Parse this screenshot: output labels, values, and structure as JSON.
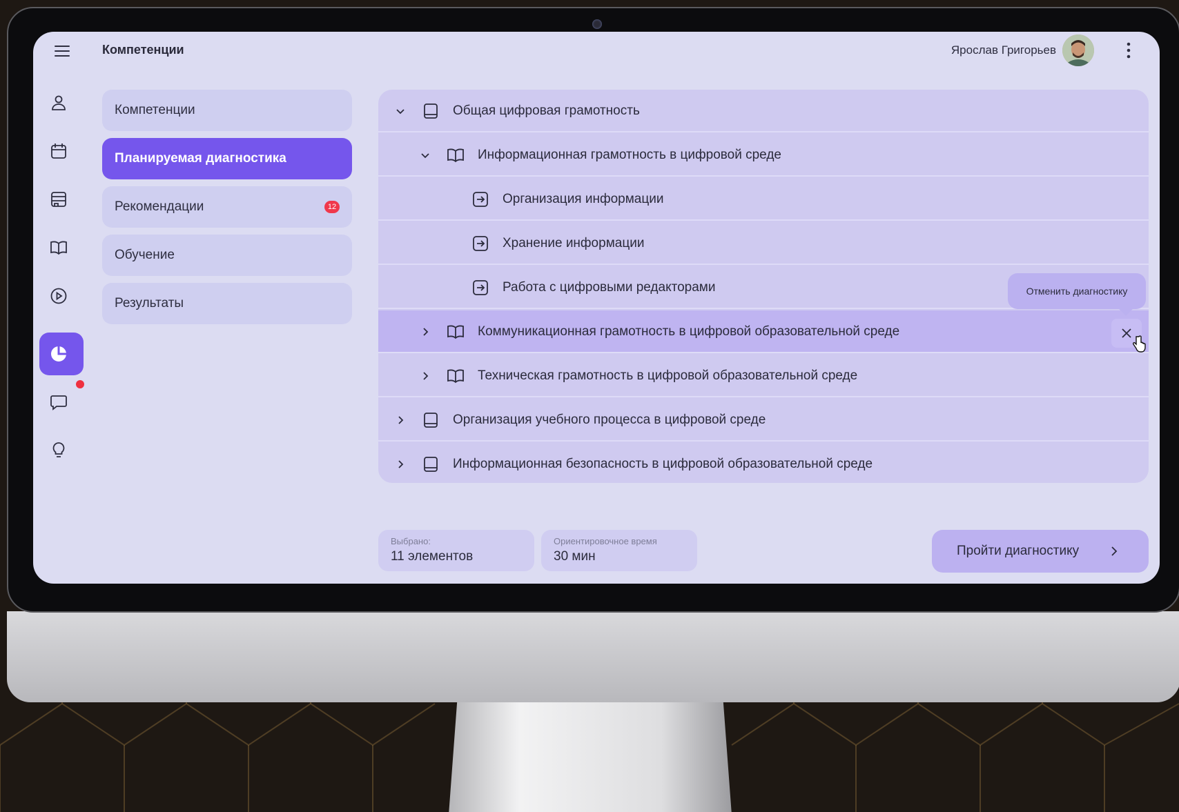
{
  "header": {
    "title": "Компетенции",
    "user_name": "Ярослав Григорьев"
  },
  "rail": {
    "icons": [
      "user-icon",
      "calendar-icon",
      "inbox-icon",
      "book-icon",
      "play-icon",
      "pie-chart-icon",
      "chat-icon",
      "lightbulb-icon"
    ],
    "active": "pie-chart-icon"
  },
  "nav": [
    {
      "label": "Компетенции"
    },
    {
      "label": "Планируемая диагностика",
      "active": true
    },
    {
      "label": "Рекомендации",
      "badge": "12"
    },
    {
      "label": "Обучение"
    },
    {
      "label": "Результаты"
    }
  ],
  "tree": [
    {
      "label": "Общая цифровая грамотность",
      "level": 0,
      "expanded": true,
      "icon": "book-closed-icon"
    },
    {
      "label": "Информационная грамотность в цифровой среде",
      "level": 1,
      "expanded": true,
      "icon": "book-open-icon"
    },
    {
      "label": "Организация информации",
      "level": 2,
      "icon": "arrow-box-icon"
    },
    {
      "label": "Хранение информации",
      "level": 2,
      "icon": "arrow-box-icon"
    },
    {
      "label": "Работа с цифровыми редакторами",
      "level": 2,
      "icon": "arrow-box-icon"
    },
    {
      "label": "Коммуникационная грамотность в цифровой образовательной среде",
      "level": 1,
      "expanded": false,
      "icon": "book-open-icon",
      "highlighted": true
    },
    {
      "label": "Техническая грамотность в цифровой  образовательной среде",
      "level": 1,
      "expanded": false,
      "icon": "book-open-icon"
    },
    {
      "label": "Организация учебного процесса в цифровой среде",
      "level": 0,
      "expanded": false,
      "icon": "book-closed-icon"
    },
    {
      "label": "Информационная безопасность в цифровой образовательной среде",
      "level": 0,
      "expanded": false,
      "icon": "book-closed-icon"
    }
  ],
  "tooltip": {
    "label": "Отменить диагностику"
  },
  "footer": {
    "selected_caption": "Выбрано:",
    "selected_value": "11 элементов",
    "time_caption": "Ориентировочное время",
    "time_value": "30 мин",
    "start_button": "Пройти диагностику"
  },
  "colors": {
    "accent": "#7556ec",
    "screen_bg": "#dcdcf2",
    "badge": "#f0384c"
  }
}
